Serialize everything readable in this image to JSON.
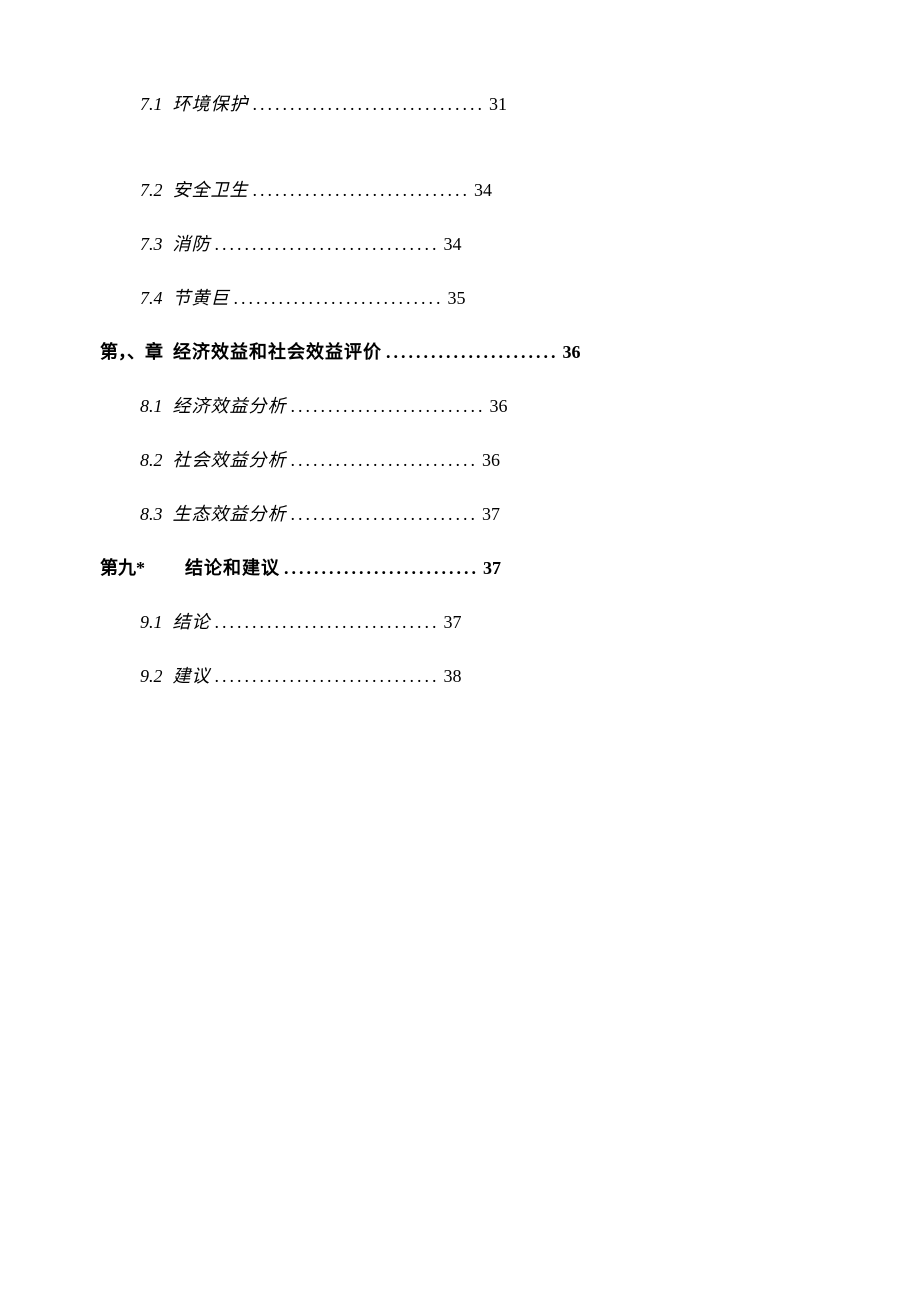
{
  "toc": [
    {
      "kind": "sub",
      "num": "7.1",
      "title": "环境保护",
      "dots": "...............................",
      "page": "31",
      "italic": true,
      "first": true
    },
    {
      "kind": "sub",
      "num": "7.2",
      "title": "安全卫生",
      "dots": ".............................",
      "page": "34",
      "italic": true
    },
    {
      "kind": "sub",
      "num": "7.3",
      "title": "消防",
      "dots": "..............................",
      "page": "34",
      "italic": true
    },
    {
      "kind": "sub",
      "num": "7.4",
      "title": "节黄巨",
      "dots": "............................",
      "page": "35",
      "italic": true
    },
    {
      "kind": "chap",
      "num": "第，、章",
      "title": "经济效益和社会效益评价",
      "dots": ".......................",
      "page": "36"
    },
    {
      "kind": "sub",
      "num": "8.1",
      "title": "经济效益分析",
      "dots": "..........................",
      "page": "36",
      "italic": true
    },
    {
      "kind": "sub",
      "num": "8.2",
      "title": "社会效益分析",
      "dots": ".........................",
      "page": "36",
      "italic": true
    },
    {
      "kind": "sub",
      "num": "8.3",
      "title": "生态效益分析",
      "dots": ".........................",
      "page": "37",
      "italic": true
    },
    {
      "kind": "chap",
      "num": "第九*",
      "title": "结论和建议",
      "dots": "..........................",
      "page": "37",
      "gap": true
    },
    {
      "kind": "sub",
      "num": "9.1",
      "title": "结论",
      "dots": "..............................",
      "page": "37",
      "italic": true
    },
    {
      "kind": "sub",
      "num": "9.2",
      "title": "建议",
      "dots": "..............................",
      "page": "38",
      "italic": true
    }
  ]
}
